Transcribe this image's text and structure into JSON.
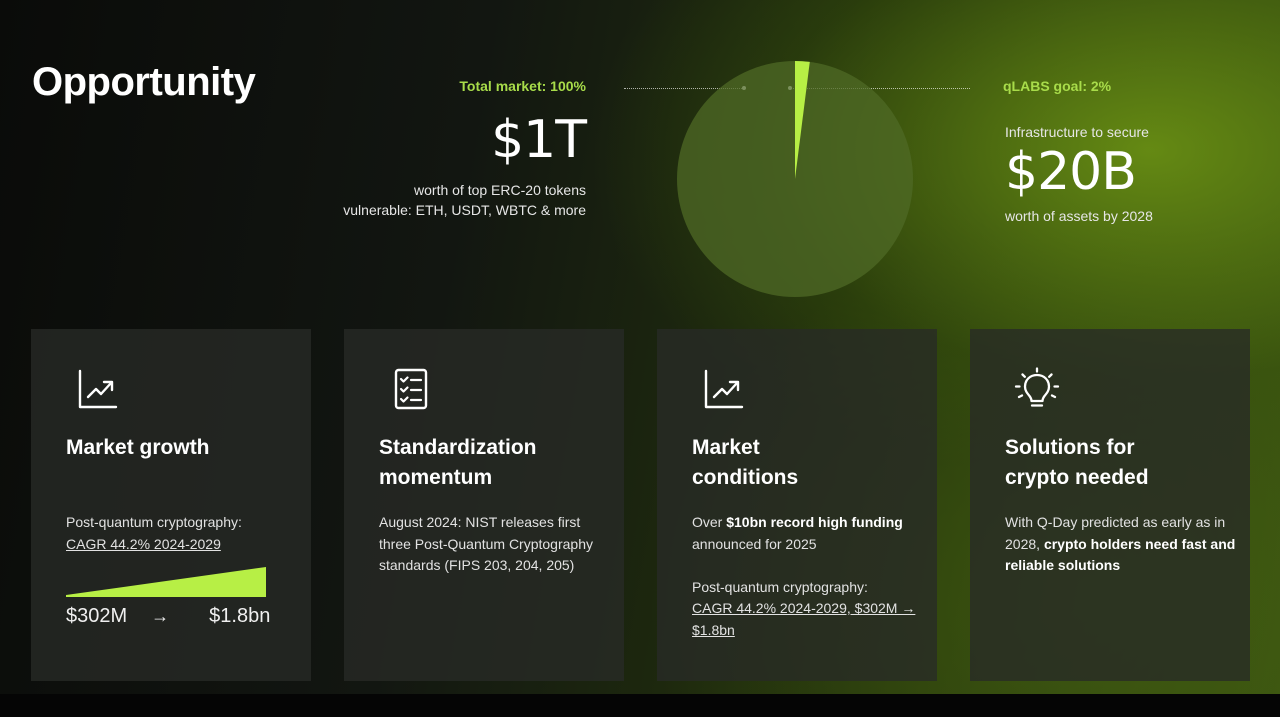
{
  "slide": {
    "title": "Opportunity",
    "accent_color": "#b7ef45"
  },
  "left_stat": {
    "label": "Total market: 100%",
    "value": "$1T",
    "desc_line1": "worth of top ERC-20 tokens",
    "desc_line2": "vulnerable: ETH, USDT, WBTC & more"
  },
  "right_stat": {
    "label": "qLABS goal: 2%",
    "subtitle": "Infrastructure to secure",
    "value": "$20B",
    "desc": "worth of assets by 2028"
  },
  "pie": {
    "total_percent": 100,
    "highlight_percent": 2,
    "highlight_color": "#b7ef45",
    "base_color": "#4f6a26"
  },
  "cards": [
    {
      "icon": "trend-chart-icon",
      "title": "Market growth",
      "body_line1": "Post-quantum cryptography:",
      "body_link": "CAGR 44.2% 2024-2029",
      "from_value": "$302M",
      "arrow": "→",
      "to_value": "$1.8bn"
    },
    {
      "icon": "checklist-icon",
      "title_line1": "Standardization",
      "title_line2": "momentum",
      "body": "August 2024: NIST releases first three Post-Quantum Cryptography standards (FIPS 203, 204, 205)"
    },
    {
      "icon": "trend-chart-icon",
      "title_line1": "Market",
      "title_line2": "conditions",
      "body_prefix": "Over ",
      "body_bold": "$10bn record high funding",
      "body_suffix": " announced for 2025",
      "body2_line": "Post-quantum cryptography:",
      "body2_link": "CAGR 44.2% 2024-2029, $302M → $1.8bn"
    },
    {
      "icon": "lightbulb-icon",
      "title_line1": "Solutions for",
      "title_line2": "crypto needed",
      "body_prefix": "With Q-Day predicted as early as in 2028, ",
      "body_bold": "crypto holders need fast and reliable solutions"
    }
  ]
}
